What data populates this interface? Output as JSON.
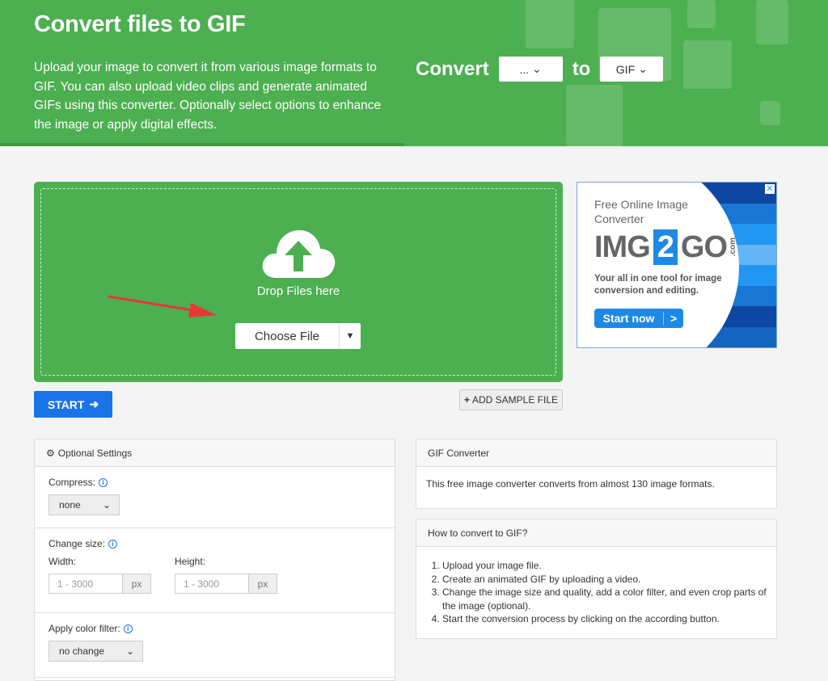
{
  "hero": {
    "title": "Convert files to GIF",
    "description": "Upload your image to convert it from various image formats to GIF. You can also upload video clips and generate animated GIFs using this converter. Optionally select options to enhance the image or apply digital effects.",
    "convert_label": "Convert",
    "from_value": "...",
    "to_label": "to",
    "to_value": "GIF",
    "bg_color": "#4caf50"
  },
  "upload": {
    "drop_text": "Drop Files here",
    "choose_label": "Choose File",
    "start_label": "START",
    "sample_label": "ADD SAMPLE FILE"
  },
  "ad": {
    "headline": "Free Online Image Converter",
    "logo": "IMG2GO.com",
    "logo_a": "IMG",
    "logo_b": "2",
    "logo_c": "GO",
    ".com": ".com",
    "body": "Your all in one tool for image conversion and editing.",
    "cta": "Start now"
  },
  "settings": {
    "title": "Optional Settings",
    "compress_label": "Compress:",
    "compress_value": "none",
    "size_label": "Change size:",
    "width_label": "Width:",
    "height_label": "Height:",
    "width_placeholder": "1 - 3000",
    "height_placeholder": "1 - 3000",
    "unit": "px",
    "filter_label": "Apply color filter:",
    "filter_value": "no change"
  },
  "info": {
    "title": "GIF Converter",
    "text": "This free image converter converts from almost 130 image formats."
  },
  "howto": {
    "title": "How to convert to GIF?",
    "steps": [
      "Upload your image file.",
      "Create an animated GIF by uploading a video.",
      "Change the image size and quality, add a color filter, and even crop parts of the image (optional).",
      "Start the conversion process by clicking on the according button."
    ]
  }
}
